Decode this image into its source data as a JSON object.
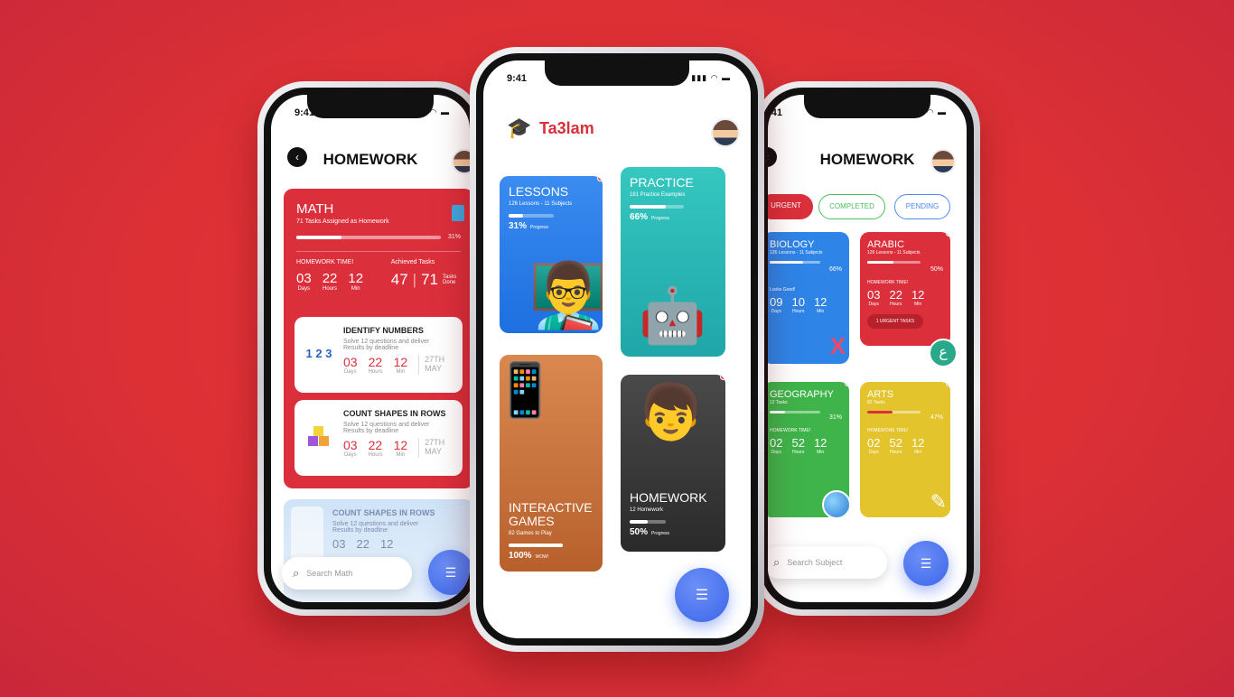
{
  "left": {
    "time": "9:41",
    "title": "HOMEWORK",
    "math": {
      "title": "MATH",
      "subtitle": "71 Tasks Assigned as Homework",
      "progress_label": "31%",
      "progress": 0.31,
      "time_label": "HOMEWORK TIME!",
      "achieved_label": "Achieved Tasks",
      "days": "03",
      "hours": "22",
      "mins": "12",
      "days_u": "Days",
      "hours_u": "Hours",
      "mins_u": "Min",
      "achieved": "47",
      "total": "71",
      "tasks_done": "Tasks Done"
    },
    "tasks": [
      {
        "title": "IDENTIFY NUMBERS",
        "desc1": "Solve 12 questions and deliver",
        "desc2": "Results by deadline",
        "d": "03",
        "h": "22",
        "m": "12",
        "date": "27TH",
        "month": "MAY"
      },
      {
        "title": "COUNT SHAPES IN ROWS",
        "desc1": "Solve 12 questions and deliver",
        "desc2": "Results by deadline",
        "d": "03",
        "h": "22",
        "m": "12",
        "date": "27TH",
        "month": "MAY"
      }
    ],
    "faded": {
      "title": "COUNT SHAPES IN ROWS",
      "desc1": "Solve 12 questions and deliver",
      "desc2": "Results by deadline",
      "d": "03",
      "h": "22",
      "m": "12"
    },
    "search_placeholder": "Search Math"
  },
  "center": {
    "time": "9:41",
    "brand": "Ta3lam",
    "tiles": {
      "lessons": {
        "title": "LESSONS",
        "sub": "126 Lessons - 11 Subjects",
        "pct": "31%",
        "progress": 0.31,
        "label": "Progress"
      },
      "practice": {
        "title": "PRACTICE",
        "sub": "181 Practice Examples",
        "pct": "66%",
        "progress": 0.66,
        "label": "Progress"
      },
      "games": {
        "title1": "INTERACTIVE",
        "title2": "GAMES",
        "sub": "82 Games to Play",
        "pct": "100%",
        "progress": 1.0,
        "label": "WOW!"
      },
      "homework": {
        "title": "HOMEWORK",
        "sub": "12 Homework",
        "pct": "50%",
        "progress": 0.5,
        "label": "Progress"
      }
    }
  },
  "right": {
    "time": "9:41",
    "title": "HOMEWORK",
    "tabs": [
      "URGENT",
      "COMPLETED",
      "PENDING"
    ],
    "subjects": {
      "biology": {
        "title": "BIOLOGY",
        "sub": "126 Lessons - 11 Subjects",
        "pct": "66%",
        "progress": 0.66,
        "note": "Looks Good!",
        "d": "09",
        "h": "10",
        "m": "12"
      },
      "arabic": {
        "title": "ARABIC",
        "sub": "126 Lessons - 11 Subjects",
        "pct": "50%",
        "progress": 0.5,
        "note": "HOMEWORK TIME!",
        "d": "03",
        "h": "22",
        "m": "12",
        "urgent": "1 URGENT TASKS"
      },
      "geography": {
        "title": "GEOGRAPHY",
        "sub": "12 Tasks",
        "pct": "31%",
        "progress": 0.31,
        "note": "HOMEWORK TIME!",
        "d": "02",
        "h": "52",
        "m": "12"
      },
      "arts": {
        "title": "ARTS",
        "sub": "82 Tasks",
        "pct": "47%",
        "progress": 0.47,
        "note": "HOMEWORK TIME!",
        "d": "02",
        "h": "52",
        "m": "12"
      }
    },
    "units": {
      "d": "Days",
      "h": "Hours",
      "m": "Min"
    },
    "search_placeholder": "Search Subject"
  },
  "colors": {
    "background": "#dc3035",
    "math_red": "#dc2f3c",
    "fab_blue": "#3b66e8",
    "brand_red": "#d6303a"
  }
}
